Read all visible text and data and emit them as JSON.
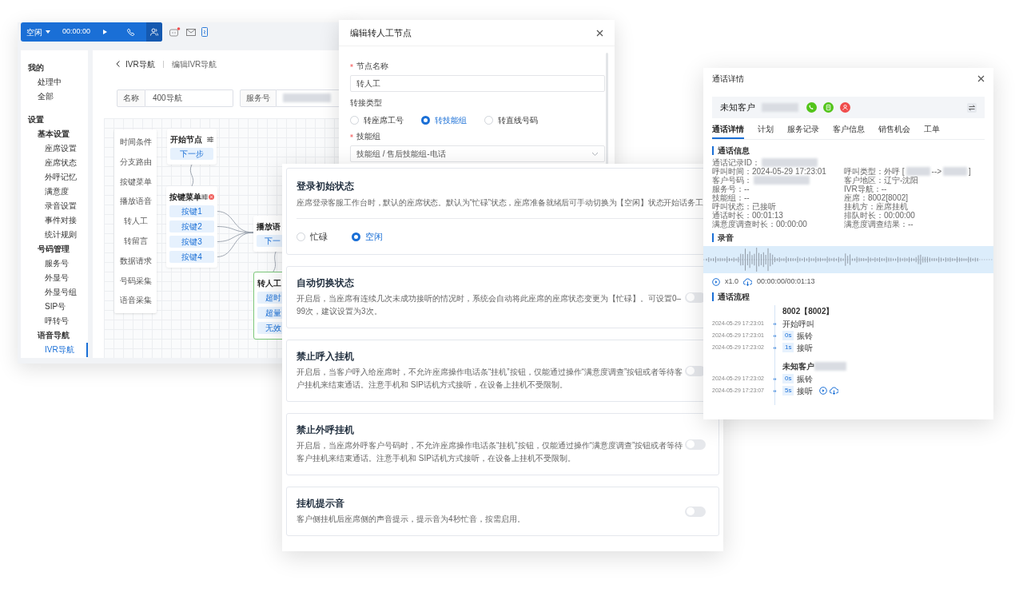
{
  "app_toolbar": {
    "status": "空闲",
    "timer": "00:00:00",
    "unread_messages": true
  },
  "sidebar": {
    "items": [
      {
        "label": "我的",
        "selected": false,
        "children": [
          {
            "label": "处理中",
            "selected": false
          },
          {
            "label": "全部",
            "selected": false
          }
        ]
      },
      {
        "label": "设置",
        "selected": false,
        "children": [
          {
            "label": "基本设置",
            "selected": false,
            "children": [
              {
                "label": "座席设置",
                "selected": false
              },
              {
                "label": "座席状态",
                "selected": false
              },
              {
                "label": "外呼记忆",
                "selected": false
              },
              {
                "label": "满意度",
                "selected": false
              },
              {
                "label": "录音设置",
                "selected": false
              },
              {
                "label": "事件对接",
                "selected": false
              },
              {
                "label": "统计规则",
                "selected": false
              }
            ]
          },
          {
            "label": "号码管理",
            "selected": false,
            "children": [
              {
                "label": "服务号",
                "selected": false
              },
              {
                "label": "外显号",
                "selected": false
              },
              {
                "label": "外显号组",
                "selected": false
              },
              {
                "label": "SIP号",
                "selected": false
              },
              {
                "label": "呼转号",
                "selected": false
              }
            ]
          },
          {
            "label": "语音导航",
            "selected": false,
            "children": [
              {
                "label": "IVR导航",
                "selected": true
              }
            ]
          }
        ]
      }
    ]
  },
  "breadcrumb": [
    "IVR导航",
    "编辑IVR导航"
  ],
  "ivr_form": [
    {
      "label": "名称",
      "value": "400导航",
      "blurred": false
    },
    {
      "label": "服务号",
      "blurred": true
    }
  ],
  "palette": [
    "时间条件",
    "分支路由",
    "按键菜单",
    "播放语音",
    "转人工",
    "转留言",
    "数据请求",
    "号码采集",
    "语音采集"
  ],
  "nodes": [
    {
      "kind": "start",
      "title": "开始节点",
      "ports": [
        "下一步"
      ],
      "selected": false
    },
    {
      "kind": "menu",
      "title": "按键菜单",
      "ports": [
        "按键1",
        "按键2",
        "按键3",
        "按键4"
      ],
      "selected": false
    },
    {
      "kind": "play",
      "title": "播放语",
      "ports": [
        "下一"
      ],
      "selected": false
    },
    {
      "kind": "transfer",
      "title": "转人工",
      "ports": [
        "超时",
        "超量",
        "无效"
      ],
      "selected": true
    }
  ],
  "node_dialog": {
    "title": "编辑转人工节点",
    "fields": [
      {
        "kind": "text",
        "label": "节点名称",
        "required": true,
        "value": "转人工"
      },
      {
        "kind": "radio",
        "label": "转接类型",
        "required": false,
        "options": [
          {
            "label": "转座席工号",
            "selected": false
          },
          {
            "label": "转技能组",
            "selected": true
          },
          {
            "label": "转直线号码",
            "selected": false
          }
        ]
      },
      {
        "kind": "select",
        "label": "技能组",
        "required": true,
        "value": "技能组 / 售后技能组-电话"
      }
    ]
  },
  "agent_settings": [
    {
      "kind": "radio",
      "title": "登录初始状态",
      "description": "座席登录客服工作台时，默认的座席状态。默认为“忙碌”状态，座席准备就绪后可手动切换为【空闲】状态开始话务工",
      "options": [
        {
          "label": "忙碌",
          "selected": false
        },
        {
          "label": "空闲",
          "selected": true
        }
      ]
    },
    {
      "kind": "toggle",
      "title": "自动切换状态",
      "description": "开启后，当座席有连续几次未成功接听的情况时，系统会自动将此座席的座席状态变更为【忙碌】。可设置0–99次，建议设置为3次。",
      "on": false
    },
    {
      "kind": "toggle",
      "title": "禁止呼入挂机",
      "description": "开启后，当客户呼入给座席时，不允许座席操作电话条“挂机”按钮，仅能通过操作“满意度调查”按钮或者等待客户挂机来结束通话。注意手机和 SIP话机方式接听，在设备上挂机不受限制。",
      "on": false
    },
    {
      "kind": "toggle",
      "title": "禁止外呼挂机",
      "description": "开启后，当座席外呼客户号码时，不允许座席操作电话条“挂机”按钮，仅能通过操作“满意度调查”按钮或者等待客户挂机来结束通话。注意手机和 SIP话机方式接听，在设备上挂机不受限制。",
      "on": false
    },
    {
      "kind": "toggle",
      "title": "挂机提示音",
      "description": "客户侧挂机后座席侧的声音提示，提示音为4秒忙音，按需启用。",
      "on": false
    }
  ],
  "call_details": {
    "title": "通话详情",
    "customer": "未知客户",
    "customer_blurred": true,
    "tabs": [
      {
        "label": "通话详情",
        "selected": true
      },
      {
        "label": "计划",
        "selected": false
      },
      {
        "label": "服务记录",
        "selected": false
      },
      {
        "label": "客户信息",
        "selected": false
      },
      {
        "label": "销售机会",
        "selected": false
      },
      {
        "label": "工单",
        "selected": false
      }
    ],
    "info_title": "通话信息",
    "info_rows": [
      [
        [
          {
            "kind": "text",
            "text": "通话记录ID："
          },
          {
            "kind": "blur"
          }
        ]
      ],
      [
        [
          {
            "kind": "text",
            "text": "呼叫时间：2024-05-29 17:23:01"
          }
        ],
        [
          {
            "kind": "text",
            "text": "呼叫类型：外呼 ["
          },
          {
            "kind": "blur"
          },
          {
            "kind": "text",
            "text": "-->"
          },
          {
            "kind": "blur"
          },
          {
            "kind": "text",
            "text": "]"
          }
        ]
      ],
      [
        [
          {
            "kind": "text",
            "text": "客户号码："
          },
          {
            "kind": "blur"
          }
        ],
        [
          {
            "kind": "text",
            "text": "客户地区：辽宁-沈阳"
          }
        ]
      ],
      [
        [
          {
            "kind": "text",
            "text": "服务号：--"
          }
        ],
        [
          {
            "kind": "text",
            "text": "IVR导航：--"
          }
        ]
      ],
      [
        [
          {
            "kind": "text",
            "text": "技能组：--"
          }
        ],
        [
          {
            "kind": "text",
            "text": "座席：8002[8002]"
          }
        ]
      ],
      [
        [
          {
            "kind": "text",
            "text": "呼叫状态：已接听"
          }
        ],
        [
          {
            "kind": "text",
            "text": "挂机方：座席挂机"
          }
        ]
      ],
      [
        [
          {
            "kind": "text",
            "text": "通话时长：00:01:13"
          }
        ],
        [
          {
            "kind": "text",
            "text": "排队时长：00:00:00"
          }
        ]
      ],
      [
        [
          {
            "kind": "text",
            "text": "满意度调查时长：00:00:00"
          }
        ],
        [
          {
            "kind": "text",
            "text": "满意度调查结果：--"
          }
        ]
      ]
    ],
    "recording_title": "录音",
    "speed": "x1.0",
    "playback_time": "00:00:00/00:01:13",
    "flow_title": "通话流程",
    "flow": [
      {
        "party": "8002【8002】",
        "party_blurred": false,
        "events": [
          {
            "time": "2024-05-29 17:23:01",
            "label": "开始呼叫",
            "playable": false
          },
          {
            "time": "2024-05-29 17:23:01",
            "duration": "0s",
            "label": "振铃",
            "playable": false
          },
          {
            "time": "2024-05-29 17:23:02",
            "duration": "1s",
            "label": "接听",
            "playable": false
          }
        ]
      },
      {
        "party": "未知客户",
        "party_blurred": true,
        "events": [
          {
            "time": "2024-05-29 17:23:02",
            "duration": "0s",
            "label": "振铃",
            "playable": false
          },
          {
            "time": "2024-05-29 17:23:07",
            "duration": "5s",
            "label": "接听",
            "playable": true
          }
        ]
      }
    ]
  }
}
